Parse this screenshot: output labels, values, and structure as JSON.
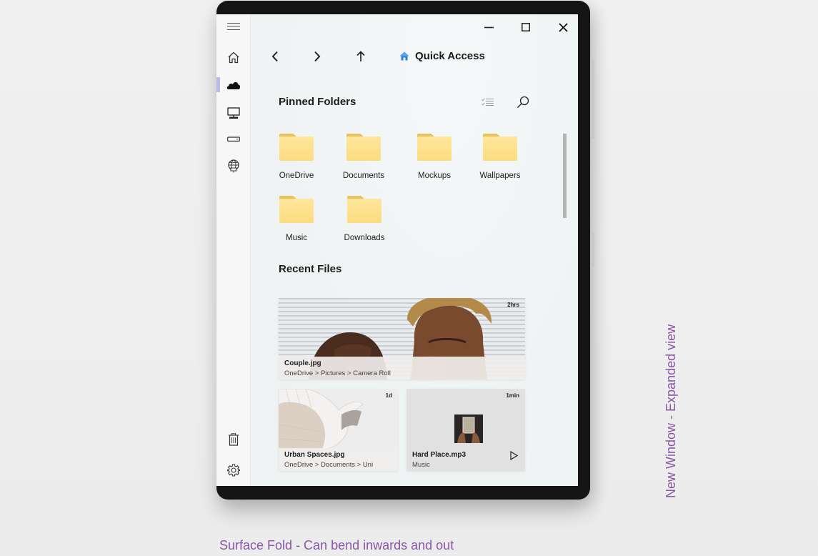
{
  "window": {
    "controls": {
      "minimize": "minimize",
      "maximize": "maximize",
      "close": "close"
    }
  },
  "rail": {
    "items": [
      {
        "name": "menu",
        "icon": "hamburger-icon"
      },
      {
        "name": "home",
        "icon": "home-icon"
      },
      {
        "name": "onedrive",
        "icon": "cloud-icon",
        "selected": true
      },
      {
        "name": "this-pc",
        "icon": "monitor-icon"
      },
      {
        "name": "drive",
        "icon": "drive-icon"
      },
      {
        "name": "network",
        "icon": "network-icon"
      },
      {
        "name": "recycle-bin",
        "icon": "trash-icon"
      },
      {
        "name": "settings",
        "icon": "gear-icon"
      }
    ],
    "indicator_color": "#b7bfe6"
  },
  "navigation": {
    "back": "back",
    "forward": "forward",
    "up": "up",
    "location_icon": "home-icon",
    "location_title": "Quick Access"
  },
  "pinned": {
    "title": "Pinned Folders",
    "tools": [
      "select-list-icon",
      "search-icon"
    ],
    "folders": [
      {
        "label": "OneDrive"
      },
      {
        "label": "Documents"
      },
      {
        "label": "Mockups"
      },
      {
        "label": "Wallpapers"
      },
      {
        "label": "Music"
      },
      {
        "label": "Downloads"
      }
    ]
  },
  "recent": {
    "title": "Recent Files",
    "files": [
      {
        "name": "Couple.jpg",
        "path": "OneDrive > Pictures > Camera Roll",
        "age": "2hrs"
      },
      {
        "name": "Urban Spaces.jpg",
        "path": "OneDrive > Documents > Uni",
        "age": "1d"
      },
      {
        "name": "Hard Place.mp3",
        "path": "Music",
        "age": "1min",
        "action": "play-icon"
      }
    ]
  },
  "captions": {
    "bottom": "Surface Fold - Can bend inwards and out",
    "side": "New Window - Expanded view"
  },
  "colors": {
    "caption": "#8a56a6",
    "folder": "#ffe08a",
    "folder_tab": "#e8c25a",
    "accent_home": "#2f7fd6"
  }
}
